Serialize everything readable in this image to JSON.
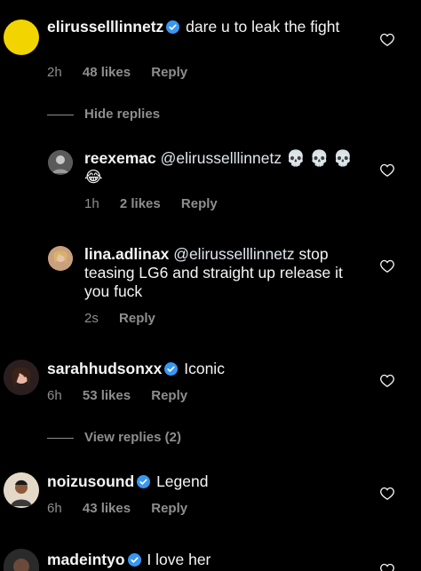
{
  "colors": {
    "background": "#000000",
    "text": "#f5f5f5",
    "meta": "#8e8e8e",
    "verified": "#3897f0"
  },
  "comments": [
    {
      "username": "elirusselllinnetz",
      "verified": true,
      "text": "dare u to leak the fight",
      "time": "2h",
      "likes": "48 likes",
      "reply_label": "Reply"
    },
    {
      "username": "reexemac",
      "verified": false,
      "mention": "@elirusselllinnetz",
      "text": "💀 💀 💀 😂",
      "time": "1h",
      "likes": "2 likes",
      "reply_label": "Reply"
    },
    {
      "username": "lina.adlinax",
      "verified": false,
      "mention": "@elirusselllinnetz",
      "text": "stop teasing LG6 and straight up release it you fuck",
      "time": "2s",
      "reply_label": "Reply"
    },
    {
      "username": "sarahhudsonxx",
      "verified": true,
      "text": "Iconic",
      "time": "6h",
      "likes": "53 likes",
      "reply_label": "Reply"
    },
    {
      "username": "noizusound",
      "verified": true,
      "text": "Legend",
      "time": "6h",
      "likes": "43 likes",
      "reply_label": "Reply"
    },
    {
      "username": "madeintyo",
      "verified": true,
      "text": "I love her"
    }
  ],
  "hide_replies_label": "Hide replies",
  "view_replies_label": "View replies (2)",
  "icons": {
    "heart": "heart-outline-icon",
    "verified": "verified-badge-icon"
  }
}
